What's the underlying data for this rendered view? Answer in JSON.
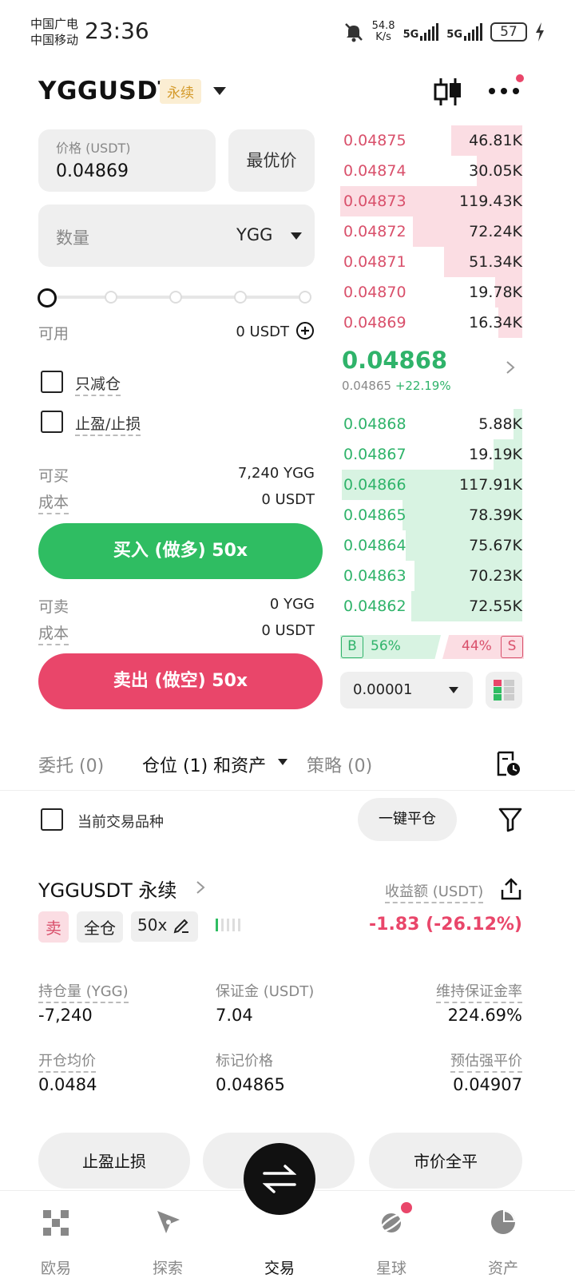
{
  "status_bar": {
    "carrier1": "中国广电",
    "carrier2": "中国移动",
    "time": "23:36",
    "net_speed_value": "54.8",
    "net_speed_unit": "K/s",
    "sim1": "5G",
    "sim2": "5G",
    "battery": "57"
  },
  "header": {
    "pair": "YGGUSDT",
    "badge": "永续"
  },
  "order_form": {
    "price_label": "价格 (USDT)",
    "price_value": "0.04869",
    "best_price_btn": "最优价",
    "qty_placeholder": "数量",
    "qty_unit": "YGG",
    "available_label": "可用",
    "available_value": "0 USDT",
    "reduce_only": "只减仓",
    "tp_sl": "止盈/止损",
    "can_buy_label": "可买",
    "can_buy_value": "7,240 YGG",
    "cost_label": "成本",
    "cost_buy_value": "0 USDT",
    "buy_btn": "买入 (做多) 50x",
    "can_sell_label": "可卖",
    "can_sell_value": "0 YGG",
    "cost_sell_value": "0 USDT",
    "sell_btn": "卖出 (做空) 50x"
  },
  "order_book": {
    "asks": [
      {
        "price": "0.04875",
        "qty": "46.81K",
        "depth": 0.39
      },
      {
        "price": "0.04874",
        "qty": "30.05K",
        "depth": 0.25
      },
      {
        "price": "0.04873",
        "qty": "119.43K",
        "depth": 1.0
      },
      {
        "price": "0.04872",
        "qty": "72.24K",
        "depth": 0.6
      },
      {
        "price": "0.04871",
        "qty": "51.34K",
        "depth": 0.43
      },
      {
        "price": "0.04870",
        "qty": "19.78K",
        "depth": 0.15
      },
      {
        "price": "0.04869",
        "qty": "16.34K",
        "depth": 0.13
      }
    ],
    "last_price": "0.04868",
    "mark_price": "0.04865",
    "change": "+22.19%",
    "bids": [
      {
        "price": "0.04868",
        "qty": "5.88K",
        "depth": 0.05
      },
      {
        "price": "0.04867",
        "qty": "19.19K",
        "depth": 0.16
      },
      {
        "price": "0.04866",
        "qty": "117.91K",
        "depth": 0.99
      },
      {
        "price": "0.04865",
        "qty": "78.39K",
        "depth": 0.66
      },
      {
        "price": "0.04864",
        "qty": "75.67K",
        "depth": 0.64
      },
      {
        "price": "0.04863",
        "qty": "70.23K",
        "depth": 0.59
      },
      {
        "price": "0.04862",
        "qty": "72.55K",
        "depth": 0.61
      }
    ],
    "buy_letter": "B",
    "buy_ratio": "56%",
    "sell_ratio": "44%",
    "sell_letter": "S",
    "precision": "0.00001"
  },
  "tabs": {
    "orders": "委托 (0)",
    "positions": "仓位 (1) 和资产",
    "strategies": "策略 (0)"
  },
  "filter": {
    "current_only": "当前交易品种",
    "close_all": "一键平仓"
  },
  "position": {
    "title": "YGGUSDT 永续",
    "side": "卖",
    "margin_mode": "全仓",
    "leverage": "50x",
    "pnl_label": "收益额 (USDT)",
    "pnl_value": "-1.83 (-26.12%)",
    "size_label": "持仓量 (YGG)",
    "size_value": "-7,240",
    "margin_label": "保证金 (USDT)",
    "margin_value": "7.04",
    "mmr_label": "维持保证金率",
    "mmr_value": "224.69%",
    "entry_label": "开仓均价",
    "entry_value": "0.0484",
    "mark_label": "标记价格",
    "mark_value": "0.04865",
    "liq_label": "预估强平价",
    "liq_value": "0.04907",
    "btn_tpsl": "止盈止损",
    "btn_close_market": "市价全平"
  },
  "nav": {
    "home": "欧易",
    "explore": "探索",
    "trade": "交易",
    "planet": "星球",
    "assets": "资产"
  },
  "colors": {
    "green": "#2fbd62",
    "red": "#e9466a",
    "badge_bg": "#fbeed3"
  }
}
